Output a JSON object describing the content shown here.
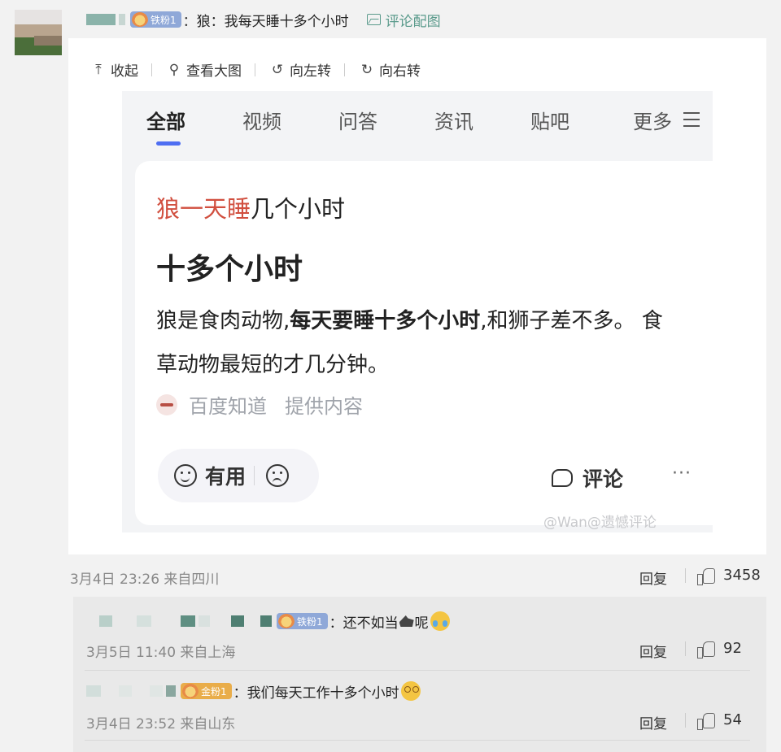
{
  "post": {
    "badge": "铁粉1",
    "text": "狼：我每天睡十多个小时",
    "pic_label": "评论配图",
    "colon": "："
  },
  "toolbar": {
    "collapse": "收起",
    "view_large": "查看大图",
    "rotate_left": "向左转",
    "rotate_right": "向右转"
  },
  "screenshot": {
    "tabs": [
      "全部",
      "视频",
      "问答",
      "资讯",
      "贴吧",
      "更多"
    ],
    "question_highlight": "狼一天睡",
    "question_rest": "几个小时",
    "answer_big": "十多个小时",
    "para_pre": "狼是食肉动物,",
    "para_bold": "每天要睡十多个小时",
    "para_post": ",和狮子差不多。 食草动物最短的才几分钟。",
    "source_name": "百度知道",
    "source_suffix": "提供内容",
    "useful": "有用",
    "comment": "评论",
    "more_dots": "···",
    "watermark": "@Wan@遗憾评论"
  },
  "main_meta": {
    "time": "3月4日 23:26 来自四川",
    "reply": "回复",
    "likes": "3458"
  },
  "replies": [
    {
      "badge": "铁粉1",
      "text_pre": "还不如当",
      "text_post": "呢",
      "time": "3月5日 11:40 来自上海",
      "reply": "回复",
      "likes": "92"
    },
    {
      "badge": "金粉1",
      "text_pre": "我们每天工作十多个小时",
      "text_post": "",
      "time": "3月4日 23:52 来自山东",
      "reply": "回复",
      "likes": "54"
    }
  ],
  "colors": {
    "accent_teal": "#5b9b8c",
    "highlight_red": "#d14f3f",
    "tab_underline": "#4e6ef2",
    "iron_badge": "#8fa8d8",
    "gold_badge": "#e9ad4a"
  }
}
